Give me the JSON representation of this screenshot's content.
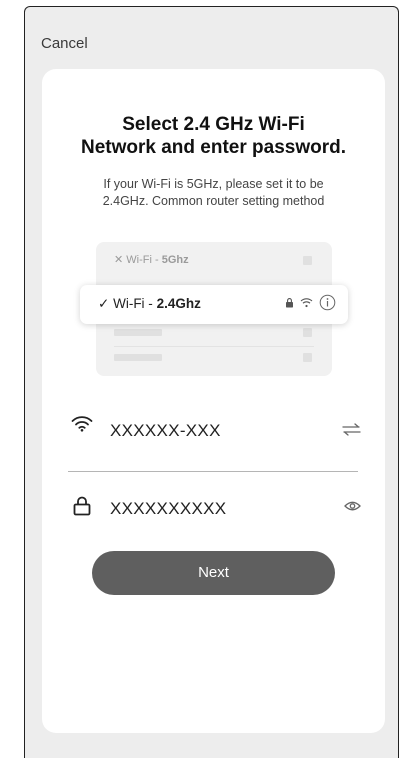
{
  "header": {
    "cancel_label": "Cancel"
  },
  "card": {
    "title_line1": "Select 2.4 GHz Wi-Fi",
    "title_line2": "Network and enter password.",
    "subtitle_line1": "If your Wi-Fi is 5GHz, please set it to be",
    "subtitle_line2": "2.4GHz. Common router setting method"
  },
  "illustration": {
    "row_5g": {
      "mark": "✕",
      "prefix": "Wi-Fi - ",
      "band": "5Ghz"
    },
    "row_24g": {
      "mark": "✓",
      "prefix": "Wi-Fi - ",
      "band": "2.4Ghz"
    },
    "icons": [
      "lock-icon",
      "wifi-icon",
      "info-icon"
    ]
  },
  "form": {
    "ssid_value": "XXXXXX-XXX",
    "password_value": "XXXXXXXXXX",
    "ssid_icon": "wifi-icon",
    "switch_icon": "swap-arrows-icon",
    "password_icon": "lock-icon",
    "visibility_icon": "eye-icon"
  },
  "actions": {
    "next_label": "Next"
  },
  "colors": {
    "screen_bg": "#ededed",
    "card_bg": "#ffffff",
    "button_bg": "#5f5f5f"
  }
}
